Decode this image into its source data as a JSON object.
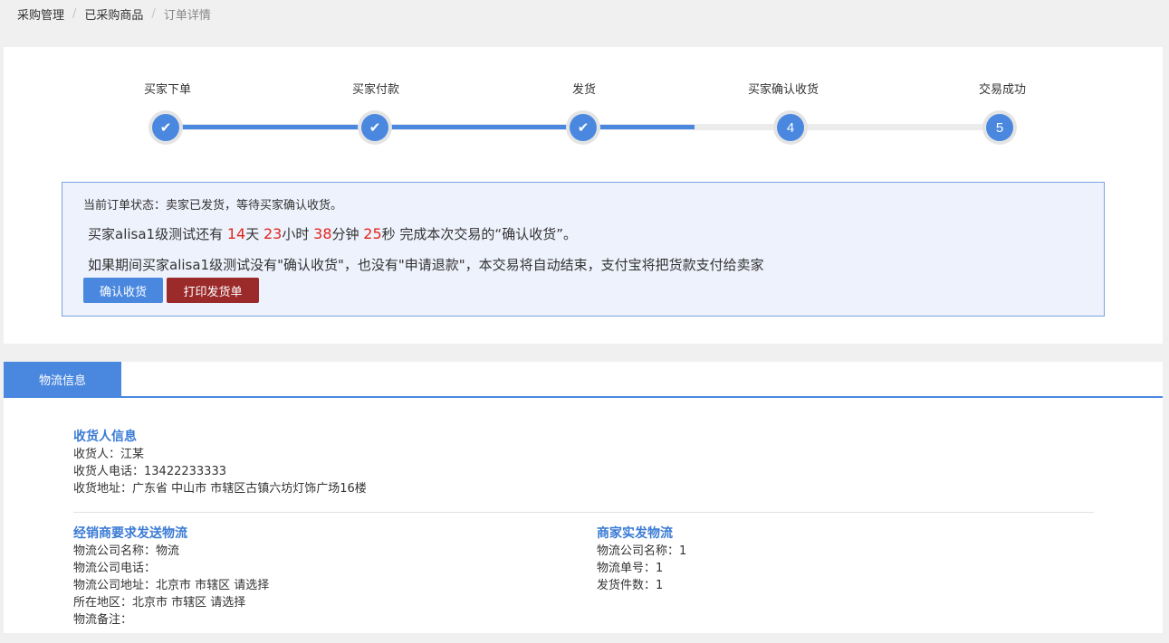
{
  "breadcrumb": [
    "采购管理",
    "已采购商品",
    "订单详情"
  ],
  "steps": [
    {
      "label": "买家下单",
      "mark": "✔"
    },
    {
      "label": "买家付款",
      "mark": "✔"
    },
    {
      "label": "发货",
      "mark": "✔"
    },
    {
      "label": "买家确认收货",
      "mark": "4"
    },
    {
      "label": "交易成功",
      "mark": "5"
    }
  ],
  "progress": {
    "completed_steps": 3,
    "total_steps": 5
  },
  "order_status": {
    "status_line": "当前订单状态：卖家已发货，等待买家确认收货。",
    "countdown": {
      "prefix": "买家alisa1级测试还有 ",
      "days": "14",
      "days_unit": "天 ",
      "hours": "23",
      "hours_unit": "小时 ",
      "minutes": "38",
      "minutes_unit": "分钟 ",
      "seconds": "25",
      "seconds_unit": "秒",
      "suffix": " 完成本次交易的“确认收货”。"
    },
    "notice": "如果期间买家alisa1级测试没有\"确认收货\"，也没有\"申请退款\"，本交易将自动结束，支付宝将把货款支付给卖家",
    "confirm_button": "确认收货",
    "print_button": "打印发货单"
  },
  "tabs": {
    "logistics": "物流信息"
  },
  "receiver": {
    "title": "收货人信息",
    "name": "收货人：江某",
    "phone": "收货人电话：13422233333",
    "address": "收货地址：广东省 中山市 市辖区古镇六坊灯饰广场16楼"
  },
  "dealer_logistics": {
    "title": "经销商要求发送物流",
    "company": "物流公司名称：物流",
    "phone": "物流公司电话：",
    "address": "物流公司地址：北京市 市辖区 请选择",
    "region": "所在地区：北京市 市辖区 请选择",
    "remark": "物流备注："
  },
  "merchant_logistics": {
    "title": "商家实发物流",
    "company": "物流公司名称：1",
    "tracking": "物流单号：1",
    "quantity": "发货件数：1"
  },
  "colors": {
    "accent": "#4a88e0",
    "countdown_number": "#e1251b",
    "print_button": "#9b2a2a",
    "section_title": "#3a7bd5"
  }
}
